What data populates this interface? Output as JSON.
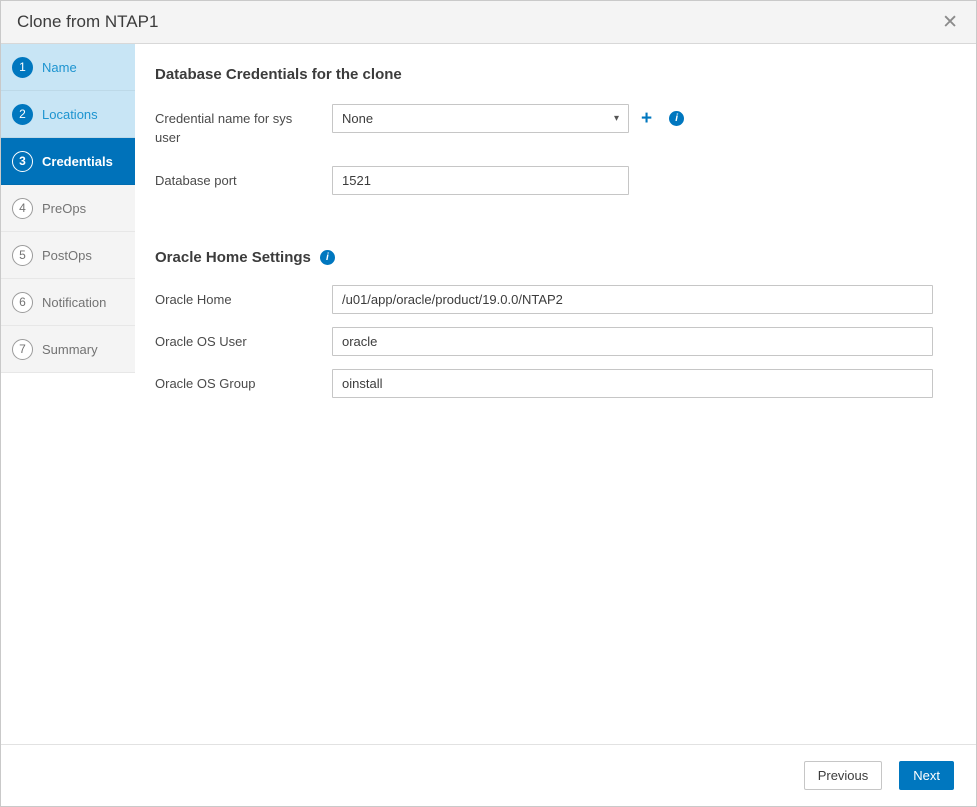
{
  "window": {
    "title": "Clone from NTAP1"
  },
  "wizard": {
    "steps": [
      {
        "number": "1",
        "label": "Name",
        "state": "done"
      },
      {
        "number": "2",
        "label": "Locations",
        "state": "done"
      },
      {
        "number": "3",
        "label": "Credentials",
        "state": "active"
      },
      {
        "number": "4",
        "label": "PreOps",
        "state": "todo"
      },
      {
        "number": "5",
        "label": "PostOps",
        "state": "todo"
      },
      {
        "number": "6",
        "label": "Notification",
        "state": "todo"
      },
      {
        "number": "7",
        "label": "Summary",
        "state": "todo"
      }
    ]
  },
  "content": {
    "db_credentials": {
      "heading": "Database Credentials for the clone",
      "credential_label": "Credential name for sys user",
      "credential_value": "None",
      "port_label": "Database port",
      "port_value": "1521"
    },
    "oracle_home": {
      "heading": "Oracle Home Settings",
      "home_label": "Oracle Home",
      "home_value": "/u01/app/oracle/product/19.0.0/NTAP2",
      "os_user_label": "Oracle OS User",
      "os_user_value": "oracle",
      "os_group_label": "Oracle OS Group",
      "os_group_value": "oinstall"
    }
  },
  "footer": {
    "previous": "Previous",
    "next": "Next"
  },
  "icons": {
    "close": "✕",
    "plus": "+",
    "info": "i",
    "caret": "▾"
  },
  "colors": {
    "accent": "#0077bf",
    "active_step_bg": "#0072ba",
    "done_step_bg": "#c8e5f5",
    "done_step_text": "#1d94d0"
  }
}
